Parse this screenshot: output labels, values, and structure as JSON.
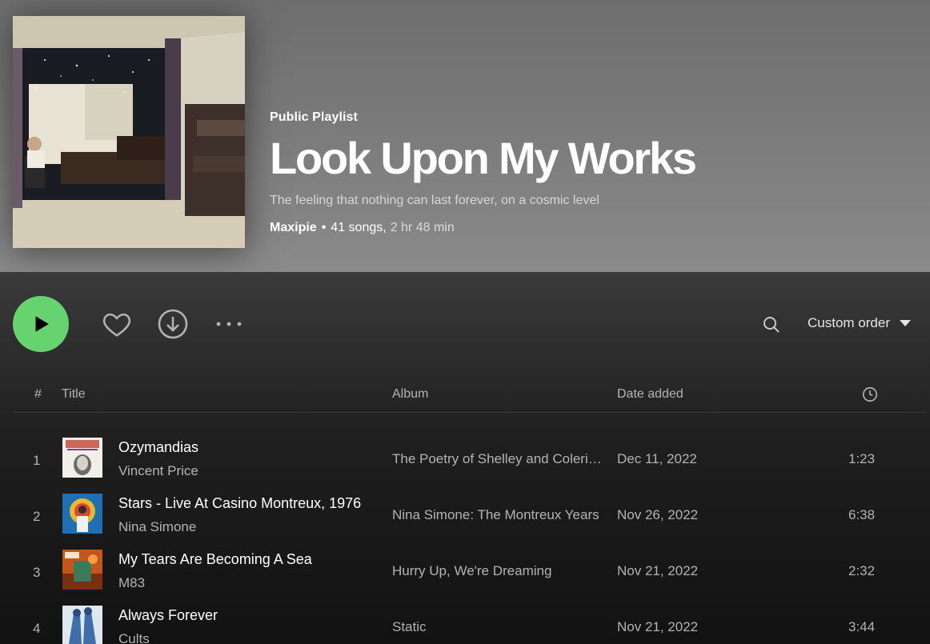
{
  "header": {
    "type_label": "Public Playlist",
    "title": "Look Upon My Works",
    "description": "The feeling that nothing can last forever, on a cosmic level",
    "owner": "Maxipie",
    "separator": "•",
    "song_count": "41 songs,",
    "duration": "2 hr 48 min"
  },
  "actions": {
    "play_icon": "play-icon",
    "like_icon": "heart-icon",
    "download_icon": "download-icon",
    "more_icon": "more-icon",
    "search_icon": "search-icon",
    "sort_label": "Custom order"
  },
  "table": {
    "headers": {
      "num": "#",
      "title": "Title",
      "album": "Album",
      "date_added": "Date added",
      "duration_icon": "clock-icon"
    },
    "rows": [
      {
        "num": "1",
        "title": "Ozymandias",
        "artist": "Vincent Price",
        "album": "The Poetry of Shelley and Coleridge",
        "date_added": "Dec 11, 2022",
        "duration": "1:23"
      },
      {
        "num": "2",
        "title": "Stars - Live At Casino Montreux, 1976",
        "artist": "Nina Simone",
        "album": "Nina Simone: The Montreux Years",
        "date_added": "Nov 26, 2022",
        "duration": "6:38"
      },
      {
        "num": "3",
        "title": "My Tears Are Becoming A Sea",
        "artist": "M83",
        "album": "Hurry Up, We're Dreaming",
        "date_added": "Nov 21, 2022",
        "duration": "2:32"
      },
      {
        "num": "4",
        "title": "Always Forever",
        "artist": "Cults",
        "album": "Static",
        "date_added": "Nov 21, 2022",
        "duration": "3:44"
      }
    ]
  },
  "colors": {
    "accent": "#66d36e",
    "background": "#121212",
    "hero": "#7a7a7a"
  }
}
